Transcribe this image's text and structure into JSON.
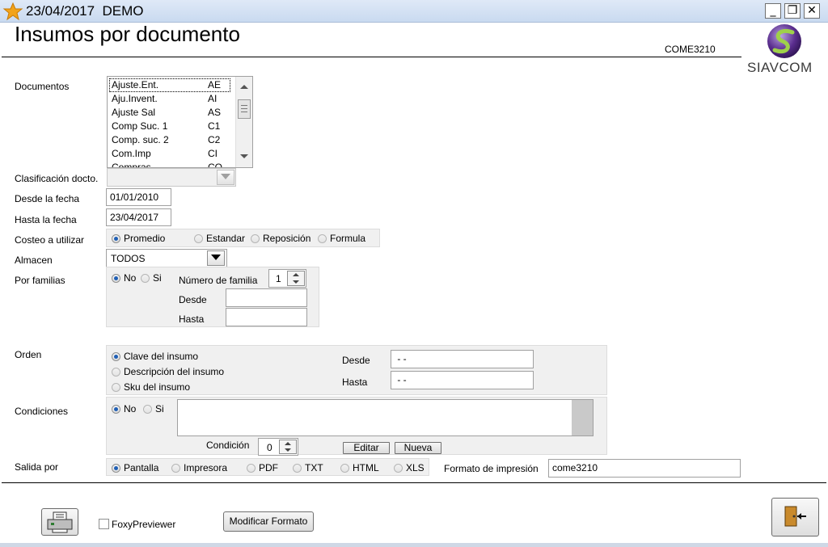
{
  "window": {
    "title": "23/04/2017  DEMO",
    "icon": "app-star-icon"
  },
  "header": {
    "title": "Insumos por documento",
    "code": "COME3210",
    "brand": "SIAVCOM"
  },
  "documentos": {
    "label": "Documentos",
    "items": [
      {
        "name": "Ajuste.Ent.",
        "code": "AE"
      },
      {
        "name": "Aju.Invent.",
        "code": "AI"
      },
      {
        "name": "Ajuste Sal",
        "code": "AS"
      },
      {
        "name": "Comp Suc. 1",
        "code": "C1"
      },
      {
        "name": "Comp. suc. 2",
        "code": "C2"
      },
      {
        "name": "Com.Imp",
        "code": "CI"
      },
      {
        "name": "Compras",
        "code": "CO"
      }
    ]
  },
  "clasificacion": {
    "label": "Clasificación docto.",
    "value": ""
  },
  "desde_fecha": {
    "label": "Desde la fecha",
    "value": "01/01/2010"
  },
  "hasta_fecha": {
    "label": "Hasta la fecha",
    "value": "23/04/2017"
  },
  "costeo": {
    "label": "Costeo a utilizar",
    "options": [
      "Promedio",
      "Estandar",
      "Reposición",
      "Formula"
    ],
    "selected": "Promedio"
  },
  "almacen": {
    "label": "Almacen",
    "value": "TODOS"
  },
  "familias": {
    "label": "Por familias",
    "no": "No",
    "si": "Si",
    "numero_label": "Número de familia",
    "numero_value": "1",
    "desde_label": "Desde",
    "desde_value": "",
    "hasta_label": "Hasta",
    "hasta_value": ""
  },
  "orden": {
    "label": "Orden",
    "options": [
      "Clave del insumo",
      "Descripción del insumo",
      "Sku del insumo"
    ],
    "selected": "Clave del insumo",
    "desde_label": "Desde",
    "desde_value": " - -",
    "hasta_label": "Hasta",
    "hasta_value": " - -"
  },
  "condiciones": {
    "label": "Condiciones",
    "no": "No",
    "si": "Si",
    "text": "",
    "condicion_label": "Condición",
    "condicion_value": "0",
    "editar": "Editar",
    "nueva": "Nueva"
  },
  "salida": {
    "label": "Salida por",
    "options": [
      "Pantalla",
      "Impresora",
      "PDF",
      "TXT",
      "HTML",
      "XLS"
    ],
    "selected": "Pantalla",
    "formato_label": "Formato de impresión",
    "formato_value": "come3210"
  },
  "footer": {
    "foxy_label": "FoxyPreviewer",
    "modificar": "Modificar Formato",
    "print_icon": "printer-icon",
    "exit_icon": "exit-door-icon"
  }
}
